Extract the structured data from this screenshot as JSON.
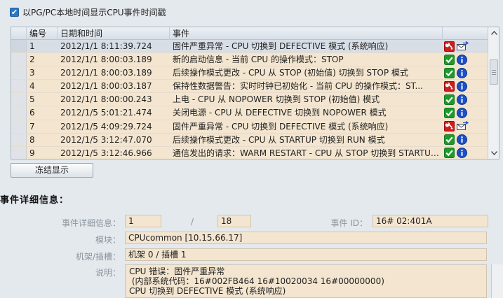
{
  "options": {
    "show_cpu_time_checked": true,
    "show_cpu_time_label": "以PG/PC本地时间显示CPU事件时间戳"
  },
  "table": {
    "columns": [
      "编号",
      "日期和时间",
      "事件"
    ],
    "rows": [
      {
        "no": "1",
        "datetime": "2012/1/1 8:11:39.724",
        "event": "固件严重异常 - CPU 切换到 DEFECTIVE 模式 (系统响应)",
        "icons": [
          "wrench-error-icon",
          "mail-export-icon"
        ],
        "selected": true
      },
      {
        "no": "2",
        "datetime": "2012/1/1 8:00:03.189",
        "event": "新的启动信息 - 当前 CPU 的操作模式：STOP",
        "icons": [
          "ok-check-icon",
          "info-icon"
        ],
        "selected": false
      },
      {
        "no": "3",
        "datetime": "2012/1/1 8:00:03.189",
        "event": "后续操作模式更改 - CPU 从 STOP (初始值) 切换到 STOP 模式",
        "icons": [
          "ok-check-icon",
          "info-icon"
        ],
        "selected": false
      },
      {
        "no": "4",
        "datetime": "2012/1/1 8:00:03.187",
        "event": "保持性数据警告：实时时钟已初始化 - 当前 CPU 的操作模式：ST...",
        "icons": [
          "wrench-error-icon",
          "info-icon"
        ],
        "selected": false
      },
      {
        "no": "5",
        "datetime": "2012/1/1 8:00:00.243",
        "event": "上电 - CPU 从 NOPOWER 切换到 STOP (初始值) 模式",
        "icons": [
          "ok-check-icon",
          "info-icon"
        ],
        "selected": false
      },
      {
        "no": "6",
        "datetime": "2012/1/5 5:01:21.474",
        "event": "关闭电源 - CPU 从 DEFECTIVE 切换到 NOPOWER 模式",
        "icons": [
          "ok-check-icon",
          "info-icon"
        ],
        "selected": false
      },
      {
        "no": "7",
        "datetime": "2012/1/5 4:09:29.724",
        "event": "固件严重异常 - CPU 切换到 DEFECTIVE 模式 (系统响应)",
        "icons": [
          "wrench-error-icon",
          "mail-export-icon"
        ],
        "selected": false
      },
      {
        "no": "8",
        "datetime": "2012/1/5 3:12:47.070",
        "event": "后续操作模式更改 - CPU 从 STARTUP 切换到 RUN 模式",
        "icons": [
          "ok-check-icon",
          "info-icon"
        ],
        "selected": false
      },
      {
        "no": "9",
        "datetime": "2012/1/5 3:12:46.966",
        "event": "通信发出的请求：WARM RESTART - CPU 从 STOP 切换到 STARTUP ...",
        "icons": [
          "ok-check-icon",
          "info-icon"
        ],
        "selected": false
      }
    ]
  },
  "buttons": {
    "freeze": "冻结显示"
  },
  "details": {
    "title": "事件详细信息：",
    "detail_label": "事件详细信息：",
    "detail_index": "1",
    "detail_total": "18",
    "slash": "/",
    "event_id_label": "事件 ID：",
    "event_id": "16# 02:401A",
    "module_label": "模块：",
    "module": "CPUcommon [10.15.66.17]",
    "rack_label": "机架/插槽：",
    "rack": "机架 0 / 插槽 1",
    "desc_label": "说明：",
    "desc_lines": [
      "CPU 错误：固件严重异常",
      " (内部系统代码：16#002FB464 16#10020034 16#00000000)",
      "CPU 切换到 DEFECTIVE 模式 (系统响应)"
    ]
  },
  "colors": {
    "row_bg": "#f3e5cf",
    "selected_bg": "#d8dee6",
    "ok": "#1c9a2a",
    "info": "#1b4fc7",
    "error": "#d01c1c"
  }
}
